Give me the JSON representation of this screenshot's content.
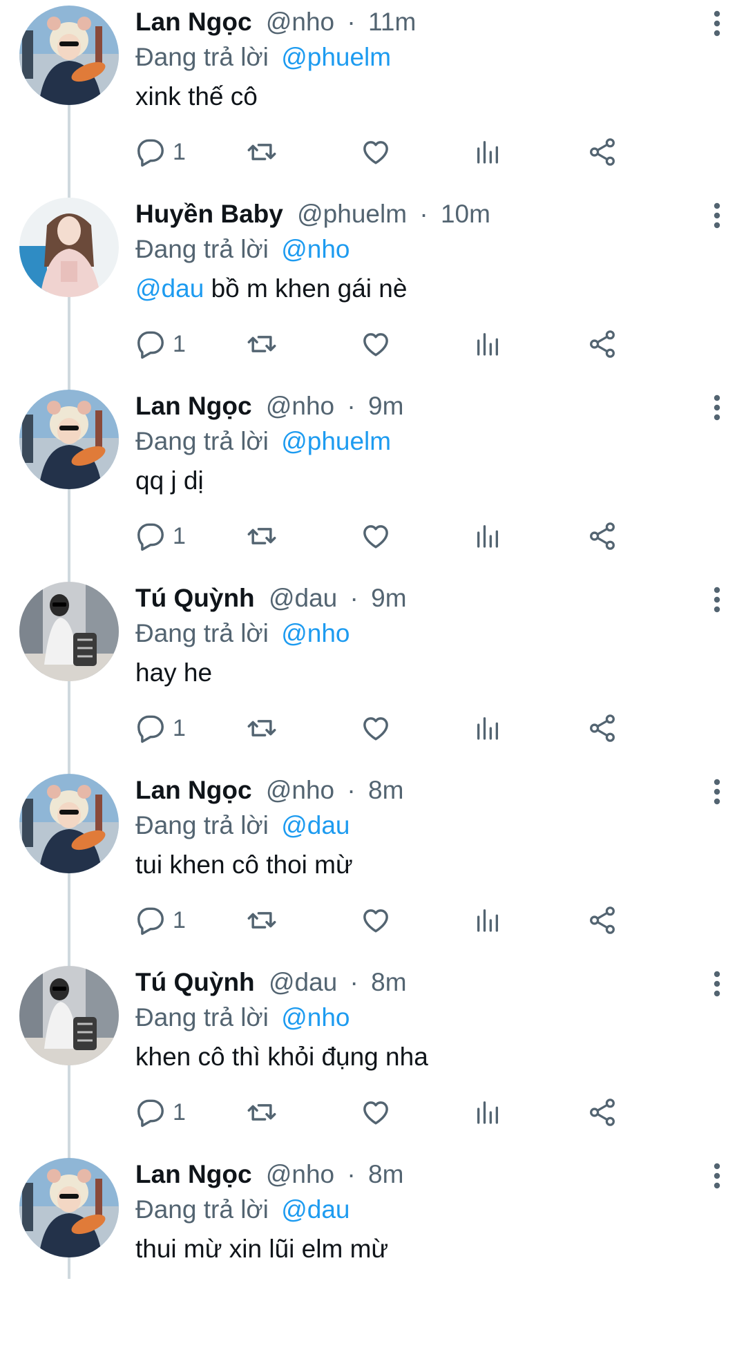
{
  "colors": {
    "accent": "#1d9bf0",
    "text_secondary": "#536471",
    "text_primary": "#0f1419",
    "thread_line": "#cfd9de"
  },
  "icons": {
    "reply": "speech-bubble-icon",
    "retweet": "retweet-icon",
    "like": "heart-icon",
    "views": "bar-chart-icon",
    "share": "share-icon",
    "more": "vertical-dots-icon"
  },
  "tweets": [
    {
      "avatar": "lan",
      "name": "Lan Ngọc",
      "handle": "@nho",
      "sep": "·",
      "time": "11m",
      "reply_prefix": "Đang trả lời",
      "reply_to": "@phuelm",
      "mention": "",
      "text": "xink thế cô",
      "reply_count": "1"
    },
    {
      "avatar": "huyen",
      "name": "Huyền Baby",
      "handle": "@phuelm",
      "sep": "·",
      "time": "10m",
      "reply_prefix": "Đang trả lời",
      "reply_to": "@nho",
      "mention": "@dau",
      "text": " bồ m khen gái nè",
      "reply_count": "1"
    },
    {
      "avatar": "lan",
      "name": "Lan Ngọc",
      "handle": "@nho",
      "sep": "·",
      "time": "9m",
      "reply_prefix": "Đang trả lời",
      "reply_to": "@phuelm",
      "mention": "",
      "text": "qq j dị",
      "reply_count": "1"
    },
    {
      "avatar": "tu",
      "name": "Tú Quỳnh",
      "handle": "@dau",
      "sep": "·",
      "time": "9m",
      "reply_prefix": "Đang trả lời",
      "reply_to": "@nho",
      "mention": "",
      "text": "hay he",
      "reply_count": "1"
    },
    {
      "avatar": "lan",
      "name": "Lan Ngọc",
      "handle": "@nho",
      "sep": "·",
      "time": "8m",
      "reply_prefix": "Đang trả lời",
      "reply_to": "@dau",
      "mention": "",
      "text": "tui khen cô thoi mừ",
      "reply_count": "1"
    },
    {
      "avatar": "tu",
      "name": "Tú Quỳnh",
      "handle": "@dau",
      "sep": "·",
      "time": "8m",
      "reply_prefix": "Đang trả lời",
      "reply_to": "@nho",
      "mention": "",
      "text": "khen cô thì khỏi đụng nha",
      "reply_count": "1"
    },
    {
      "avatar": "lan",
      "name": "Lan Ngọc",
      "handle": "@nho",
      "sep": "·",
      "time": "8m",
      "reply_prefix": "Đang trả lời",
      "reply_to": "@dau",
      "mention": "",
      "text": "thui mừ xin lũi elm mừ",
      "reply_count": ""
    }
  ]
}
